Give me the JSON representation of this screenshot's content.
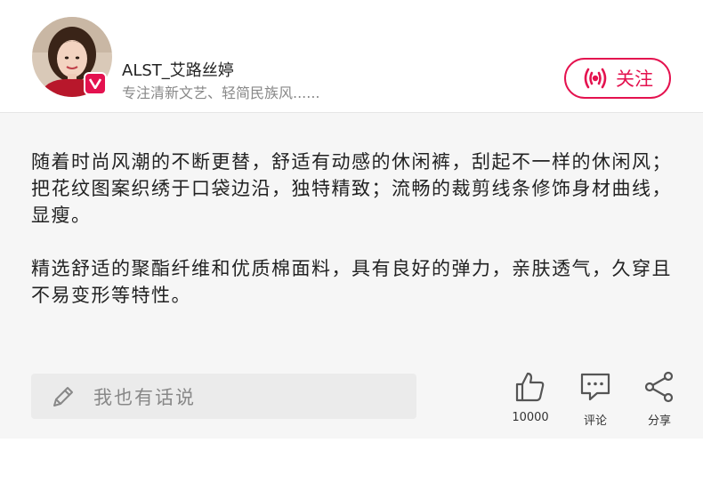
{
  "author": {
    "username": "ALST_艾路丝婷",
    "bio": "专注清新文艺、轻简民族风......",
    "avatar_icon": "avatar-photo",
    "badge_icon": "v-badge-icon"
  },
  "follow": {
    "label": "关注",
    "icon": "broadcast-icon",
    "color": "#e4124f"
  },
  "post": {
    "paragraphs": [
      "随着时尚风潮的不断更替，舒适有动感的休闲裤，刮起不一样的休闲风；把花纹图案织绣于口袋边沿，独特精致；流畅的裁剪线条修饰身材曲线，显瘦。",
      "精选舒适的聚酯纤维和优质棉面料，具有良好的弹力，亲肤透气，久穿且不易变形等特性。"
    ]
  },
  "comment_input": {
    "placeholder": "我也有话说",
    "icon": "pencil-icon"
  },
  "actions": {
    "like": {
      "label": "10000",
      "icon": "thumbs-up-icon"
    },
    "comment": {
      "label": "评论",
      "icon": "speech-bubble-icon"
    },
    "share": {
      "label": "分享",
      "icon": "share-icon"
    }
  }
}
